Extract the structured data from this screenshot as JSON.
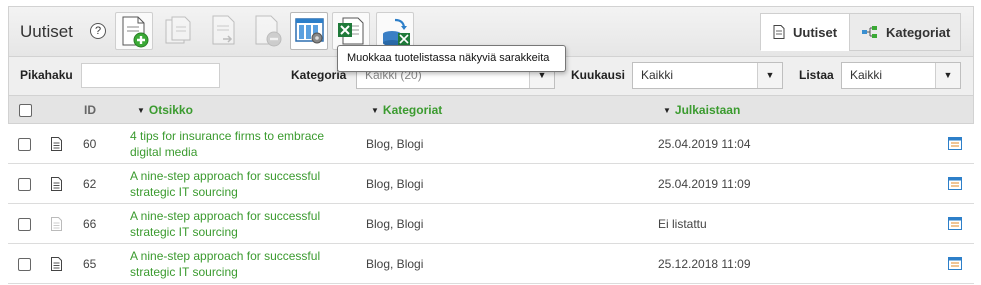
{
  "header": {
    "title": "Uutiset",
    "help_glyph": "?",
    "toolbar_buttons": [
      {
        "name": "new-item",
        "icon": "document-add-icon",
        "state": "enabled"
      },
      {
        "name": "copy-items",
        "icon": "documents-copy-icon",
        "state": "disabled"
      },
      {
        "name": "move-item",
        "icon": "document-move-icon",
        "state": "disabled"
      },
      {
        "name": "delete-item",
        "icon": "document-remove-icon",
        "state": "disabled"
      },
      {
        "name": "edit-columns",
        "icon": "columns-settings-icon",
        "state": "active"
      },
      {
        "name": "excel-export",
        "icon": "excel-icon",
        "state": "enabled"
      },
      {
        "name": "import-data",
        "icon": "database-import-icon",
        "state": "enabled"
      }
    ],
    "tabs": [
      {
        "label": "Uutiset",
        "icon": "document-icon",
        "active": true
      },
      {
        "label": "Kategoriat",
        "icon": "tree-icon",
        "active": false
      }
    ]
  },
  "tooltip": {
    "text": "Muokkaa tuotelistassa näkyviä sarakkeita"
  },
  "filters": {
    "quicksearch_label": "Pikahaku",
    "quicksearch_value": "",
    "category_label": "Kategoria",
    "category_value": "Kaikki (20)",
    "month_label": "Kuukausi",
    "month_value": "Kaikki",
    "list_label": "Listaa",
    "list_value": "Kaikki"
  },
  "table": {
    "columns": {
      "id": "ID",
      "title": "Otsikko",
      "categories": "Kategoriat",
      "published": "Julkaistaan"
    },
    "rows": [
      {
        "id": "60",
        "title": "4 tips for insurance firms to embrace digital media",
        "categories": "Blog, Blogi",
        "published": "25.04.2019 11:04",
        "listed": true
      },
      {
        "id": "62",
        "title": "A nine-step approach for successful strategic IT sourcing",
        "categories": "Blog, Blogi",
        "published": "25.04.2019 11:09",
        "listed": true
      },
      {
        "id": "66",
        "title": "A nine-step approach for successful strategic IT sourcing",
        "categories": "Blog, Blogi",
        "published": "Ei listattu",
        "listed": false
      },
      {
        "id": "65",
        "title": "A nine-step approach for successful strategic IT sourcing",
        "categories": "Blog, Blogi",
        "published": "25.12.2018 11:09",
        "listed": true
      }
    ]
  },
  "colors": {
    "link": "#3b9b2f",
    "header_bg": "#e4e4e4",
    "toolbar_bg": "#ececec",
    "accent_blue": "#2d7fc9"
  }
}
